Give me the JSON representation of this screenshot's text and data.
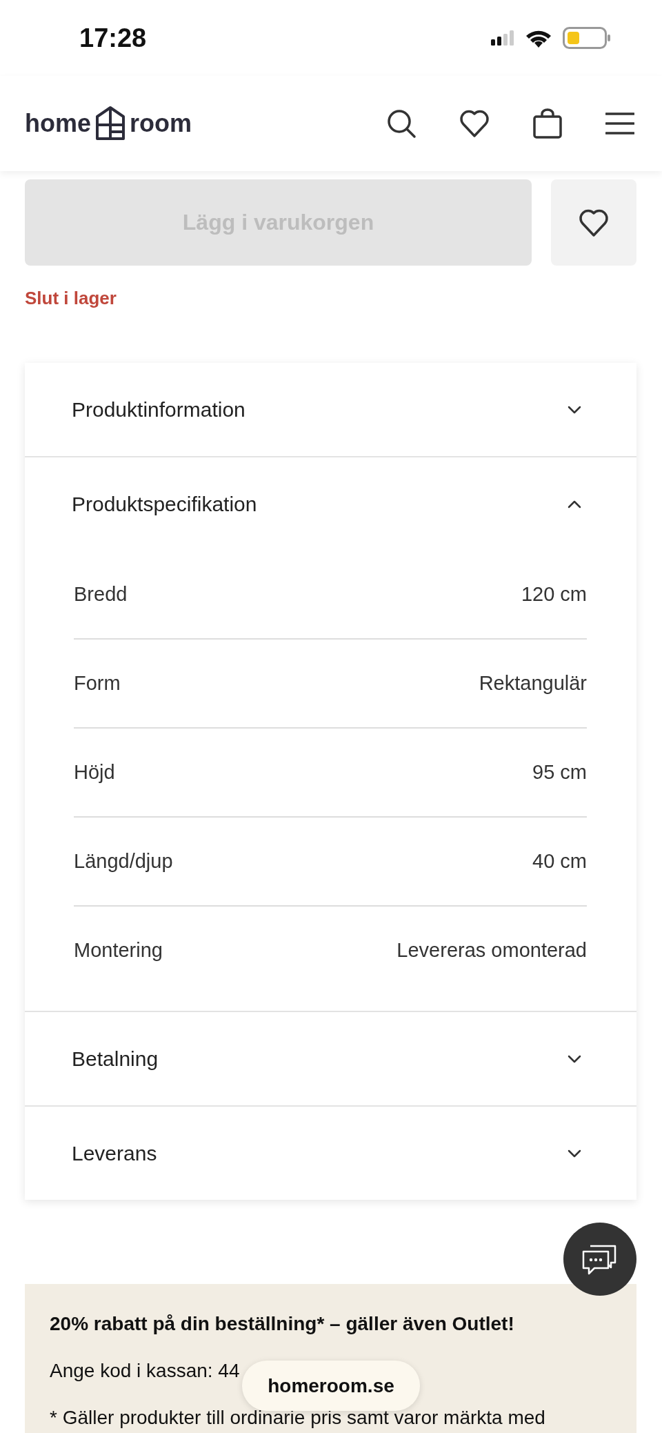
{
  "status_bar": {
    "time": "17:28"
  },
  "header": {
    "logo": [
      "home",
      "room"
    ]
  },
  "purchase": {
    "add_to_cart": {
      "label": "Lägg i varukorgen",
      "disabled": true
    },
    "stock_status": "Slut i lager"
  },
  "accordion": [
    {
      "title": "Produktinformation",
      "expanded": false
    },
    {
      "title": "Produktspecifikation",
      "expanded": true,
      "specs": [
        {
          "name": "Bredd",
          "value": "120 cm"
        },
        {
          "name": "Form",
          "value": "Rektangulär"
        },
        {
          "name": "Höjd",
          "value": "95 cm"
        },
        {
          "name": "Längd/djup",
          "value": "40 cm"
        },
        {
          "name": "Montering",
          "value": "Levereras omonterad"
        }
      ]
    },
    {
      "title": "Betalning",
      "expanded": false
    },
    {
      "title": "Leverans",
      "expanded": false
    }
  ],
  "promo": {
    "title": "20% rabatt på din beställning* – gäller även Outlet!",
    "code_text": "Ange kod i kassan: 44",
    "note": "* Gäller produkter till ordinarie pris samt varor märkta med"
  },
  "url_pill": "homeroom.se"
}
